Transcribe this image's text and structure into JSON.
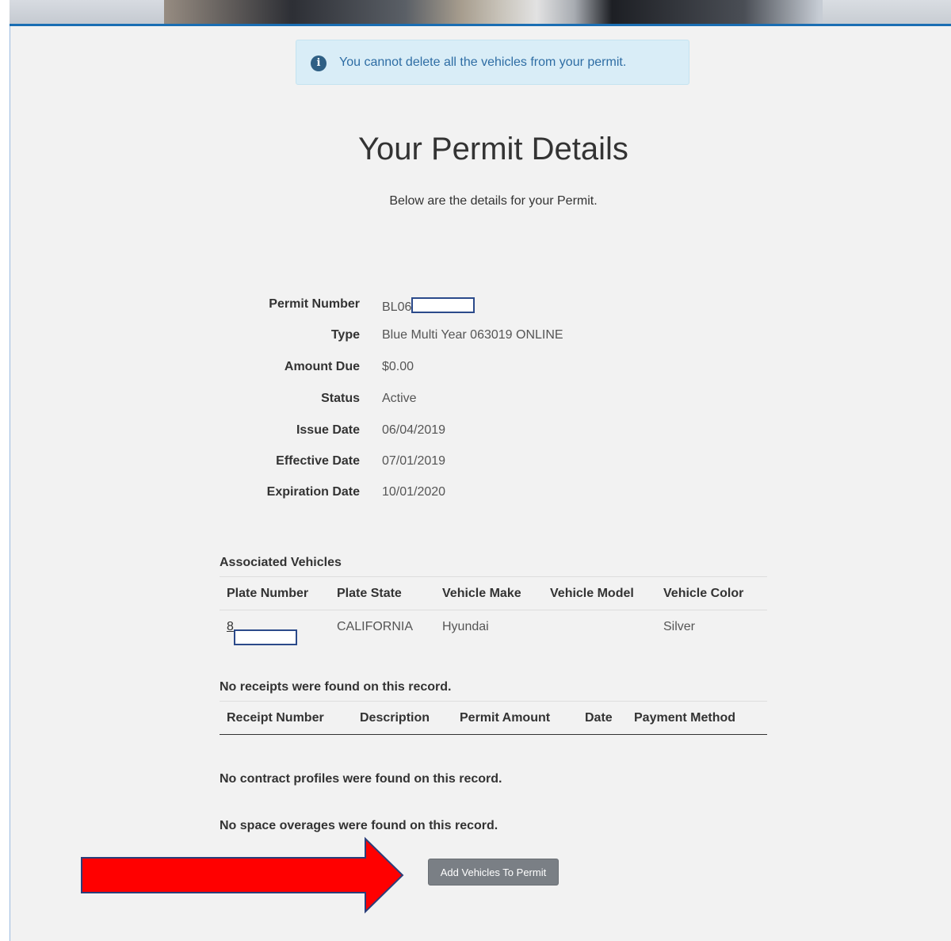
{
  "alert": {
    "icon": "info-icon",
    "message": "You cannot delete all the vehicles from your permit."
  },
  "header": {
    "title": "Your Permit Details",
    "subtitle": "Below are the details for your Permit."
  },
  "permit": {
    "fields": [
      {
        "label": "Permit Number",
        "value": "BL06"
      },
      {
        "label": "Type",
        "value": "Blue Multi Year 063019 ONLINE"
      },
      {
        "label": "Amount Due",
        "value": "$0.00"
      },
      {
        "label": "Status",
        "value": "Active"
      },
      {
        "label": "Issue Date",
        "value": "06/04/2019"
      },
      {
        "label": "Effective Date",
        "value": "07/01/2019"
      },
      {
        "label": "Expiration Date",
        "value": "10/01/2020"
      }
    ]
  },
  "vehicles": {
    "title": "Associated Vehicles",
    "columns": [
      "Plate Number",
      "Plate State",
      "Vehicle Make",
      "Vehicle Model",
      "Vehicle Color"
    ],
    "rows": [
      {
        "plate": "8",
        "state": "CALIFORNIA",
        "make": "Hyundai",
        "model": "",
        "color": "Silver"
      }
    ]
  },
  "receipts": {
    "title": "No receipts were found on this record.",
    "columns": [
      "Receipt Number",
      "Description",
      "Permit Amount",
      "Date",
      "Payment Method"
    ]
  },
  "contracts": {
    "message": "No contract profiles were found on this record."
  },
  "overages": {
    "message": "No space overages were found on this record."
  },
  "actions": {
    "add_vehicles_label": "Add Vehicles To Permit"
  },
  "annotation": {
    "arrow_color": "#ff0000",
    "arrow_outline": "#2b3f7a",
    "arrow_icon": "right-arrow-icon"
  }
}
